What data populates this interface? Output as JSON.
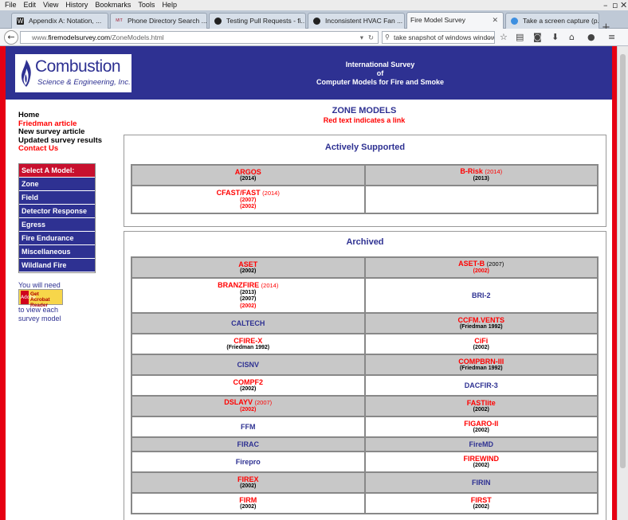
{
  "menu": [
    "File",
    "Edit",
    "View",
    "History",
    "Bookmarks",
    "Tools",
    "Help"
  ],
  "tabs": [
    {
      "label": "Appendix A: Notation, ...",
      "icon": "W"
    },
    {
      "label": "Phone Directory Search ...",
      "icon": "MIT"
    },
    {
      "label": "Testing Pull Requests - fi...",
      "icon": "github-icon"
    },
    {
      "label": "Inconsistent HVAC Fan ...",
      "icon": "github-icon"
    },
    {
      "label": "Fire Model Survey",
      "icon": ""
    },
    {
      "label": "Take a screen capture (p...",
      "icon": "globe-icon"
    }
  ],
  "url": {
    "prefix": "www.",
    "host": "firemodelsurvey.com",
    "path": "/ZoneModels.html"
  },
  "search": "take snapshot of windows window",
  "logo": {
    "line1": "Combustion",
    "line2": "Science & Engineering, Inc."
  },
  "banner": {
    "line1": "International Survey",
    "line2": "of",
    "line3": "Computer Models for Fire and Smoke"
  },
  "leftnav": [
    {
      "label": "Home",
      "color": "black"
    },
    {
      "label": "Friedman article",
      "color": "red"
    },
    {
      "label": "New survey article",
      "color": "black"
    },
    {
      "label": "Updated survey results",
      "color": "black"
    },
    {
      "label": "Contact Us",
      "color": "red"
    }
  ],
  "model_menu": {
    "header": "Select A Model:",
    "items": [
      "Zone",
      "Field",
      "Detector Response",
      "Egress",
      "Fire Endurance",
      "Miscellaneous",
      "Wildland Fire"
    ]
  },
  "acrobat": {
    "pre": "You will need",
    "post1": "to view each",
    "post2": "survey model",
    "badge_a": "Adobe",
    "badge_get": "Get",
    "badge_1": "Acrobat",
    "badge_2": "Reader"
  },
  "page": {
    "title": "ZONE MODELS",
    "subtitle": "Red text indicates a link"
  },
  "sections": [
    {
      "title": "Actively Supported",
      "rows": [
        [
          {
            "name": "ARGOS",
            "name_color": "red",
            "name_suffix": "",
            "notes": [
              {
                "t": "(2014)",
                "c": "k"
              }
            ]
          },
          {
            "name": "B-Risk",
            "name_color": "red",
            "name_suffix": "(2014)",
            "notes": [
              {
                "t": "(2013)",
                "c": "k"
              }
            ]
          }
        ],
        [
          {
            "name": "CFAST/FAST",
            "name_color": "red",
            "name_suffix": "(2014)",
            "notes": [
              {
                "t": "(2007)",
                "c": "r"
              },
              {
                "t": "(2002)",
                "c": "r"
              }
            ]
          },
          {
            "name": "",
            "name_color": "blue",
            "name_suffix": "",
            "notes": []
          }
        ]
      ]
    },
    {
      "title": "Archived",
      "rows": [
        [
          {
            "name": "ASET",
            "name_color": "red",
            "name_suffix": "",
            "notes": [
              {
                "t": "(2002)",
                "c": "k"
              }
            ]
          },
          {
            "name": "ASET-B",
            "name_color": "red",
            "name_suffix": "(2007)",
            "suffix_black": true,
            "notes": [
              {
                "t": "(2002)",
                "c": "r"
              }
            ]
          }
        ],
        [
          {
            "name": "BRANZFIRE",
            "name_color": "red",
            "name_suffix": "(2014)",
            "notes": [
              {
                "t": "(2013)",
                "c": "k"
              },
              {
                "t": "(2007)",
                "c": "k"
              },
              {
                "t": "(2002)",
                "c": "r"
              }
            ]
          },
          {
            "name": "BRI-2",
            "name_color": "blue",
            "name_suffix": "",
            "notes": []
          }
        ],
        [
          {
            "name": "CALTECH",
            "name_color": "blue",
            "name_suffix": "",
            "notes": []
          },
          {
            "name": "CCFM.VENTS",
            "name_color": "red",
            "name_suffix": "",
            "notes": [
              {
                "t": "(Friedman 1992)",
                "c": "k"
              }
            ]
          }
        ],
        [
          {
            "name": "CFIRE-X",
            "name_color": "red",
            "name_suffix": "",
            "notes": [
              {
                "t": "(Friedman 1992)",
                "c": "k"
              }
            ]
          },
          {
            "name": "CiFi",
            "name_color": "red",
            "name_suffix": "",
            "notes": [
              {
                "t": "(2002)",
                "c": "k"
              }
            ]
          }
        ],
        [
          {
            "name": "CISNV",
            "name_color": "blue",
            "name_suffix": "",
            "notes": []
          },
          {
            "name": "COMPBRN-III",
            "name_color": "red",
            "name_suffix": "",
            "notes": [
              {
                "t": "(Friedman 1992)",
                "c": "k"
              }
            ]
          }
        ],
        [
          {
            "name": "COMPF2",
            "name_color": "red",
            "name_suffix": "",
            "notes": [
              {
                "t": "(2002)",
                "c": "k"
              }
            ]
          },
          {
            "name": "DACFIR-3",
            "name_color": "blue",
            "name_suffix": "",
            "notes": []
          }
        ],
        [
          {
            "name": "DSLAYV",
            "name_color": "red",
            "name_suffix": "(2007)",
            "notes": [
              {
                "t": "(2002)",
                "c": "r"
              }
            ]
          },
          {
            "name": "FASTlite",
            "name_color": "red",
            "name_suffix": "",
            "notes": [
              {
                "t": "(2002)",
                "c": "k"
              }
            ]
          }
        ],
        [
          {
            "name": "FFM",
            "name_color": "blue",
            "name_suffix": "",
            "notes": []
          },
          {
            "name": "FIGARO-II",
            "name_color": "red",
            "name_suffix": "",
            "notes": [
              {
                "t": "(2002)",
                "c": "k"
              }
            ]
          }
        ],
        [
          {
            "name": "FIRAC",
            "name_color": "blue",
            "name_suffix": "",
            "notes": []
          },
          {
            "name": "FireMD",
            "name_color": "blue",
            "name_suffix": "",
            "notes": []
          }
        ],
        [
          {
            "name": "Firepro",
            "name_color": "blue",
            "name_suffix": "",
            "notes": []
          },
          {
            "name": "FIREWIND",
            "name_color": "red",
            "name_suffix": "",
            "notes": [
              {
                "t": "(2002)",
                "c": "k"
              }
            ]
          }
        ],
        [
          {
            "name": "FIREX",
            "name_color": "red",
            "name_suffix": "",
            "notes": [
              {
                "t": "(2002)",
                "c": "k"
              }
            ]
          },
          {
            "name": "FIRIN",
            "name_color": "blue",
            "name_suffix": "",
            "notes": []
          }
        ],
        [
          {
            "name": "FIRM",
            "name_color": "red",
            "name_suffix": "",
            "notes": [
              {
                "t": "(2002)",
                "c": "k"
              }
            ]
          },
          {
            "name": "FIRST",
            "name_color": "red",
            "name_suffix": "",
            "notes": [
              {
                "t": "(2002)",
                "c": "k"
              }
            ]
          }
        ]
      ]
    }
  ],
  "colors": {
    "banner": "#2e3192",
    "link_red": "#ff0000",
    "menu_header": "#c8102e",
    "cell_gray": "#c8c8c8",
    "frame_red": "#e60012"
  }
}
